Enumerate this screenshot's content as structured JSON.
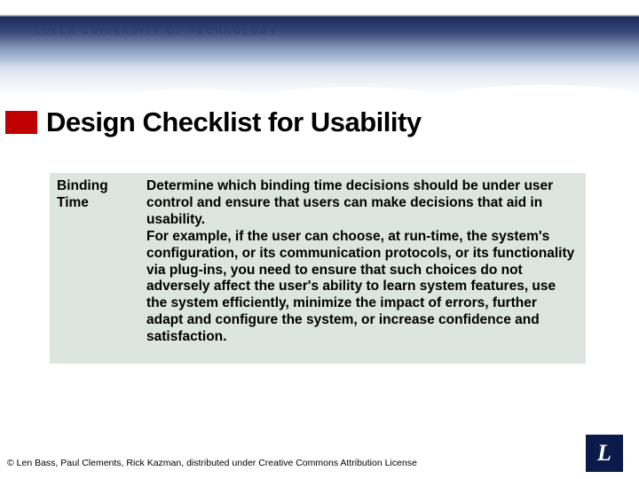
{
  "university": "LULEÅ  UNIVERSITY  OF  TECHNOLOGY",
  "title": "Design Checklist for Usability",
  "table": {
    "left": "Binding Time",
    "right_p1": "Determine which binding time decisions should be under user control and ensure that users can make decisions that aid in usability.",
    "right_p2": "For example, if the user can choose, at run-time, the system's configuration, or its communication protocols, or its functionality via plug-ins, you need to ensure that such choices do not adversely affect the user's ability to learn system features, use the system efficiently, minimize the impact of errors, further adapt and configure the system, or increase confidence and satisfaction."
  },
  "footer": "© Len Bass, Paul Clements, Rick Kazman, distributed under Creative Commons Attribution License",
  "logo_letter": "L"
}
